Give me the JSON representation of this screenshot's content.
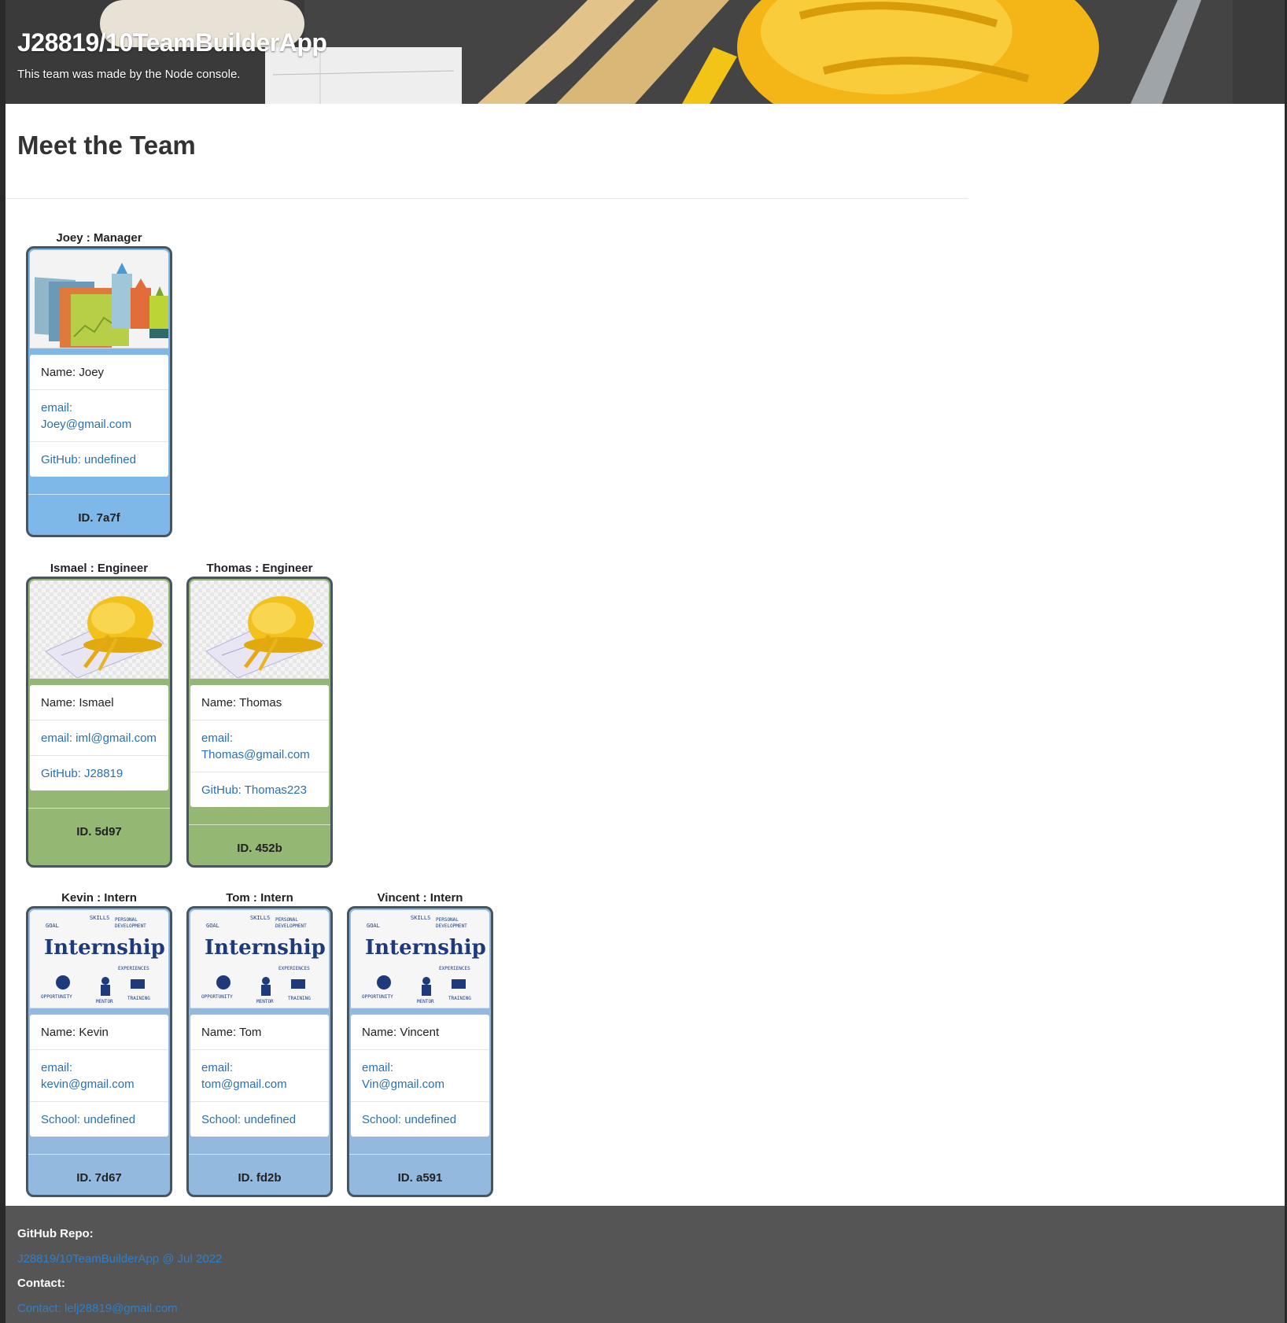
{
  "header": {
    "title": "J28819/10TeamBuilderApp",
    "subtitle": "This team was made by the Node console."
  },
  "main": {
    "heading": "Meet the Team"
  },
  "team": {
    "manager": {
      "label": "Joey : Manager",
      "name": "Name: Joey",
      "email": "email: Joey@gmail.com",
      "extra": "GitHub: undefined",
      "id": "ID. 7a7f"
    },
    "engineers": [
      {
        "label": "Ismael : Engineer",
        "name": "Name: Ismael",
        "email": "email: iml@gmail.com",
        "extra": "GitHub: J28819",
        "id": "ID. 5d97"
      },
      {
        "label": "Thomas : Engineer",
        "name": "Name: Thomas",
        "email": "email: Thomas@gmail.com",
        "extra": "GitHub: Thomas223",
        "id": "ID. 452b"
      }
    ],
    "interns": [
      {
        "label": "Kevin : Intern",
        "name": "Name: Kevin",
        "email": "email: kevin@gmail.com",
        "extra": "School: undefined",
        "id": "ID. 7d67"
      },
      {
        "label": "Tom : Intern",
        "name": "Name: Tom",
        "email": "email: tom@gmail.com",
        "extra": "School: undefined",
        "id": "ID. fd2b"
      },
      {
        "label": "Vincent : Intern",
        "name": "Name: Vincent",
        "email": "email: Vin@gmail.com",
        "extra": "School: undefined",
        "id": "ID. a591"
      }
    ],
    "intern_picture": {
      "title": "Internship",
      "words": [
        "GOAL",
        "SKILLS",
        "PERSONAL DEVELOPMENT",
        "EXPERIENCES",
        "OPPORTUNITY",
        "MENTOR",
        "TRAINING"
      ]
    }
  },
  "footer": {
    "repo_label": "GitHub Repo:",
    "repo_link": "J28819/10TeamBuilderApp @ Jul 2022",
    "contact_label": "Contact:",
    "contact_link": "Contact: lelj28819@gmail.com"
  },
  "colors": {
    "manager_card": "#7db8e8",
    "engineer_card": "#94b774",
    "intern_card": "#93b9de",
    "footer_bg": "#555555",
    "link": "#2a6fb3"
  }
}
